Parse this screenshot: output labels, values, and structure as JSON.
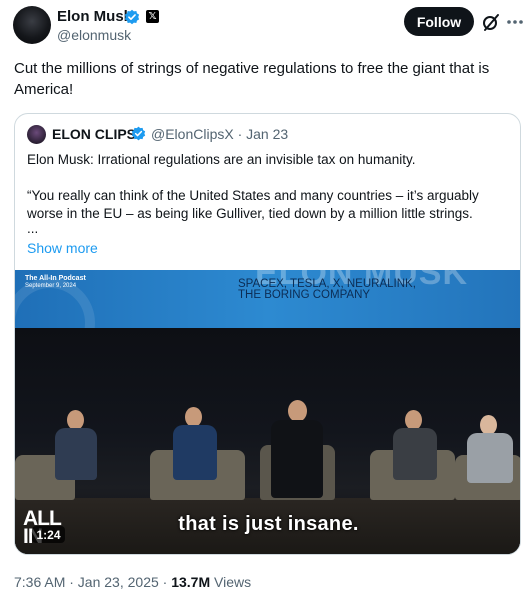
{
  "author": {
    "name": "Elon Musk",
    "handle": "@elonmusk"
  },
  "follow_label": "Follow",
  "tweet_text": "Cut the millions of strings of negative regulations to free the giant that is America!",
  "quote": {
    "name": "ELON CLIPS",
    "handle_date": "@ElonClipsX · Jan 23",
    "line1": "Elon Musk: Irrational regulations are an invisible tax on humanity.",
    "line2": "“You really can think of the United States and many countries – it’s arguably worse in the EU – as being like Gulliver, tied down by a million little strings.",
    "ellipsis": "...",
    "show_more": "Show more"
  },
  "video": {
    "podcast_line1": "The All-In Podcast",
    "podcast_line2": "September 9, 2024",
    "screen_big_text": "ELON MUSK",
    "companies": "SPACEX, TESLA, X, NEURALINK,\nTHE BORING COMPANY",
    "caption": "that is just insane.",
    "logo": "ALL\nIN",
    "duration": "1:24"
  },
  "meta": {
    "time": "7:36 AM · Jan 23, 2025 · ",
    "views_count": "13.7M",
    "views_label": " Views"
  },
  "colors": {
    "verified_blue": "#1d9bf0",
    "link_blue": "#1d9bf0",
    "secondary_text": "#536471",
    "primary_text": "#0f1419"
  },
  "icons": [
    "verified-badge-icon",
    "x-affiliate-icon",
    "grok-icon",
    "more-icon"
  ]
}
